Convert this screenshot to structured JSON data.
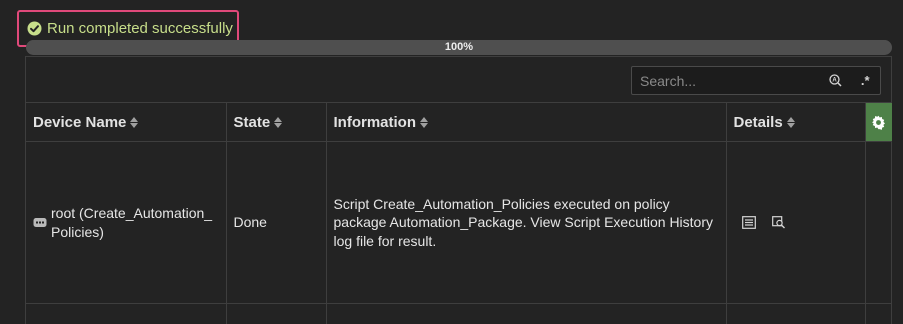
{
  "status": {
    "message": "Run completed successfully",
    "icon": "check-circle-icon",
    "text_color": "#c7de8a",
    "border_color": "#e0497a"
  },
  "progress": {
    "label": "100%",
    "value": 1.0
  },
  "search": {
    "placeholder": "Search...",
    "value": "",
    "icons": [
      "match-case-icon",
      "regex-icon"
    ],
    "regex_label": ".*"
  },
  "table": {
    "columns": [
      {
        "label": "Device Name"
      },
      {
        "label": "State"
      },
      {
        "label": "Information"
      },
      {
        "label": "Details"
      }
    ],
    "settings_icon": "gear-icon",
    "accent_color": "#4e8148",
    "rows": [
      {
        "device_icon": "device-icon",
        "device_name": "root (Create_Automation_Policies)",
        "state": "Done",
        "information": "Script Create_Automation_Policies executed on policy package Automation_Package. View Script Execution History log file for result.",
        "detail_icons": [
          "log-view-icon",
          "search-detail-icon"
        ]
      }
    ]
  }
}
